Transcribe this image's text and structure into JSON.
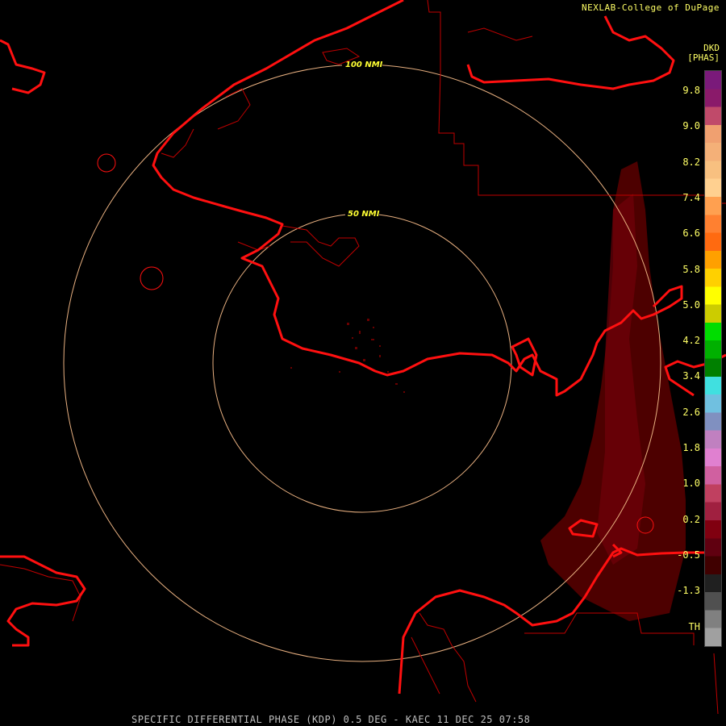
{
  "header": {
    "credit": "NEXLAB-College of DuPage"
  },
  "product": {
    "code": "DKD",
    "units": "[PHAS]"
  },
  "rings": [
    {
      "label": "100 NMI"
    },
    {
      "label": "50 NMI"
    }
  ],
  "legend": {
    "ticks": [
      "9.8",
      "9.0",
      "8.2",
      "7.4",
      "6.6",
      "5.8",
      "5.0",
      "4.2",
      "3.4",
      "2.6",
      "1.8",
      "1.0",
      "0.2",
      "-0.5",
      "-1.3",
      "TH"
    ],
    "colors": [
      "#7a1a7a",
      "#8a1a6a",
      "#c04a6a",
      "#f0a070",
      "#f4b078",
      "#f8c080",
      "#ffd090",
      "#ffa050",
      "#ff8030",
      "#ff6a10",
      "#ffa000",
      "#ffd000",
      "#ffff00",
      "#cccc00",
      "#00dd00",
      "#00b000",
      "#008000",
      "#40e0e0",
      "#70c0e0",
      "#8090c0",
      "#c080c0",
      "#e080d0",
      "#d060a0",
      "#c04060",
      "#a02040",
      "#800010",
      "#600010",
      "#400000",
      "#202020",
      "#505050",
      "#808080",
      "#a0a0a0"
    ]
  },
  "footer": {
    "caption": "SPECIFIC DIFFERENTIAL PHASE (KDP) 0.5 DEG - KAEC 11 DEC 25 07:58"
  }
}
